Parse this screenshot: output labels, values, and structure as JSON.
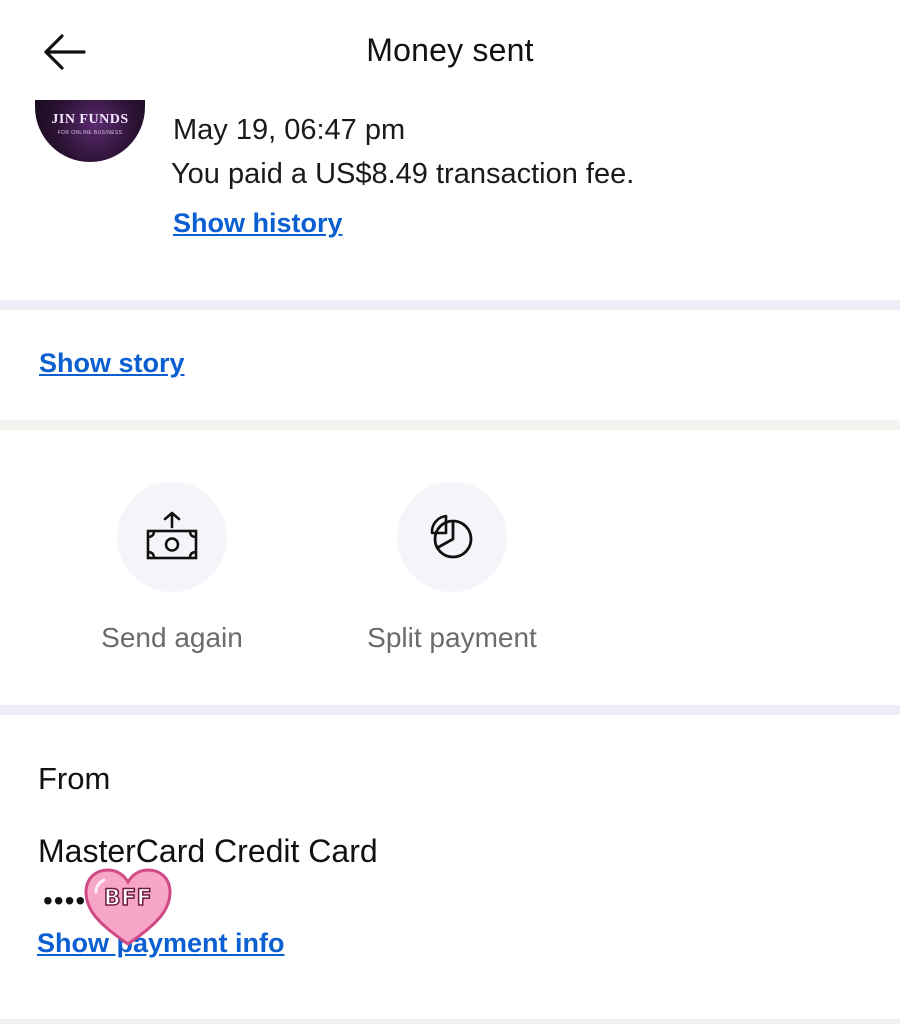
{
  "header": {
    "title": "Money sent",
    "back_icon": "arrow-left-icon"
  },
  "transaction": {
    "avatar_text": "JIN FUNDS",
    "avatar_subtext": "FOR ONLINE BUSINESS",
    "date": "May 19, 06:47 pm",
    "fee_text": "You paid a US$8.49 transaction fee.",
    "show_history_label": "Show history"
  },
  "story": {
    "show_story_label": "Show story"
  },
  "actions": [
    {
      "label": "Send again",
      "icon": "send-money-icon"
    },
    {
      "label": "Split payment",
      "icon": "pie-chart-icon"
    }
  ],
  "from": {
    "label": "From",
    "card_name": "MasterCard Credit Card",
    "card_masked": "••••",
    "show_payment_label": "Show payment info"
  },
  "sticker": {
    "text": "BFF",
    "color": "#f7a6c8"
  },
  "colors": {
    "link": "#0b5fd1",
    "divider": "#eeeef8",
    "action_circle": "#f4f5f9",
    "muted_text": "#6b6b6b"
  }
}
